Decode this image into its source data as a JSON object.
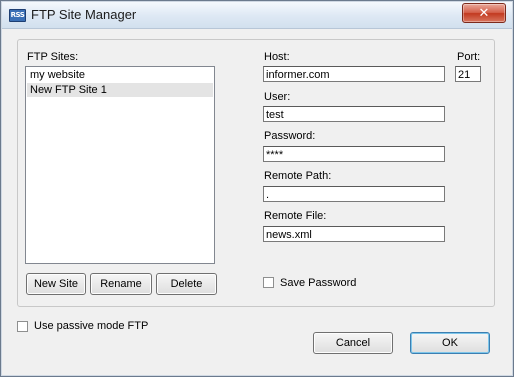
{
  "window": {
    "title": "FTP Site Manager",
    "icon_label": "RSS",
    "close_symbol": "✕"
  },
  "sites": {
    "label": "FTP Sites:",
    "items": [
      {
        "label": "my website",
        "selected": false
      },
      {
        "label": "New FTP Site 1",
        "selected": true
      }
    ],
    "buttons": {
      "new": "New Site",
      "rename": "Rename",
      "delete": "Delete"
    }
  },
  "form": {
    "host_label": "Host:",
    "host_value": "informer.com",
    "port_label": "Port:",
    "port_value": "21",
    "user_label": "User:",
    "user_value": "test",
    "password_label": "Password:",
    "password_value": "****",
    "remote_path_label": "Remote Path:",
    "remote_path_value": ".",
    "remote_file_label": "Remote File:",
    "remote_file_value": "news.xml",
    "save_password_label": "Save Password",
    "save_password_checked": false
  },
  "passive": {
    "label": "Use passive mode FTP",
    "checked": false
  },
  "footer": {
    "cancel": "Cancel",
    "ok": "OK"
  }
}
